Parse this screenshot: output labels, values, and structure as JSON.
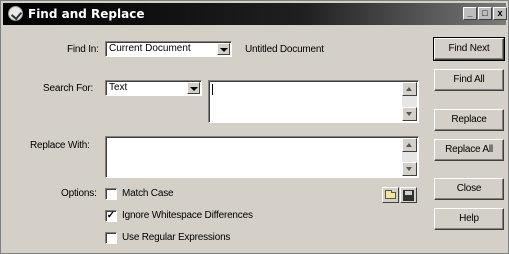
{
  "window": {
    "title": "Find and Replace",
    "controls": [
      "_",
      "□",
      "x"
    ]
  },
  "find_in": {
    "label": "Find In:",
    "selected": "Current Document",
    "document_name": "Untitled Document"
  },
  "search_for": {
    "label": "Search For:",
    "selected": "Text",
    "value": ""
  },
  "replace_with": {
    "label": "Replace With:",
    "value": ""
  },
  "options": {
    "label": "Options:",
    "items": [
      {
        "label": "Match Case",
        "checked": false
      },
      {
        "label": "Ignore Whitespace Differences",
        "checked": true
      },
      {
        "label": "Use Regular Expressions",
        "checked": false
      }
    ]
  },
  "icons": {
    "open": "folder-icon",
    "save": "disk-icon"
  },
  "buttons": {
    "find_next": "Find Next",
    "find_all": "Find All",
    "replace": "Replace",
    "replace_all": "Replace All",
    "close": "Close",
    "help": "Help"
  }
}
